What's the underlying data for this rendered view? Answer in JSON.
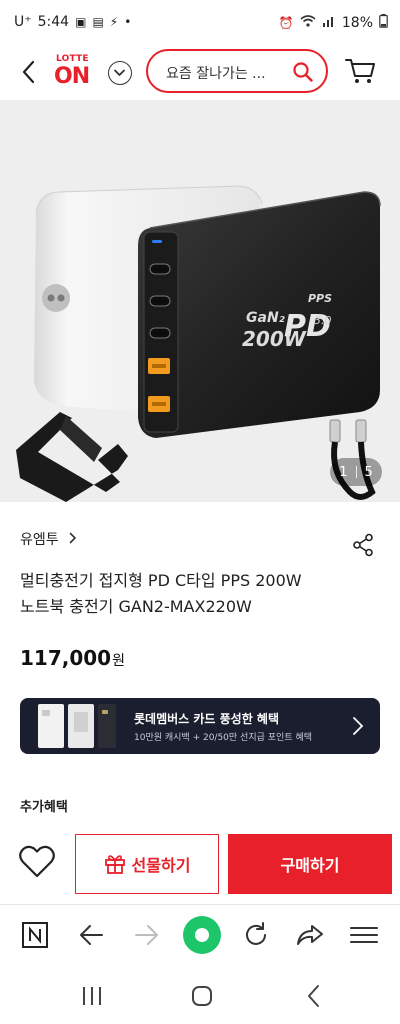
{
  "status_bar": {
    "carrier": "U⁺",
    "time": "5:44",
    "battery": "18%"
  },
  "header": {
    "logo_top": "LOTTE",
    "logo_bottom": "ON",
    "search_placeholder": "요즘 잘나가는 ..."
  },
  "hero": {
    "product_label_gan": "GaN₂",
    "product_label_watt": "200W",
    "product_label_pd": "PD",
    "product_label_pps": "PPS",
    "product_label_ver": "3.0",
    "current_image": "1",
    "total_images": "5"
  },
  "product": {
    "brand": "유엠투",
    "title_line1": "멀티충전기 접지형 PD C타입 PPS 200W",
    "title_line2": "노트북 충전기 GAN2-MAX220W",
    "price": "117,000",
    "currency": "원"
  },
  "banner": {
    "title": "롯데멤버스 카드 풍성한 혜택",
    "subtitle": "10만원 캐시백 + 20/50만 선지급 포인트 혜택"
  },
  "extra_benefits_label": "추가혜택",
  "actions": {
    "gift_label": "선물하기",
    "buy_label": "구매하기"
  },
  "colors": {
    "accent": "#e8202a",
    "banner_bg": "#1a1e2e",
    "browser_home": "#1ec66a"
  }
}
